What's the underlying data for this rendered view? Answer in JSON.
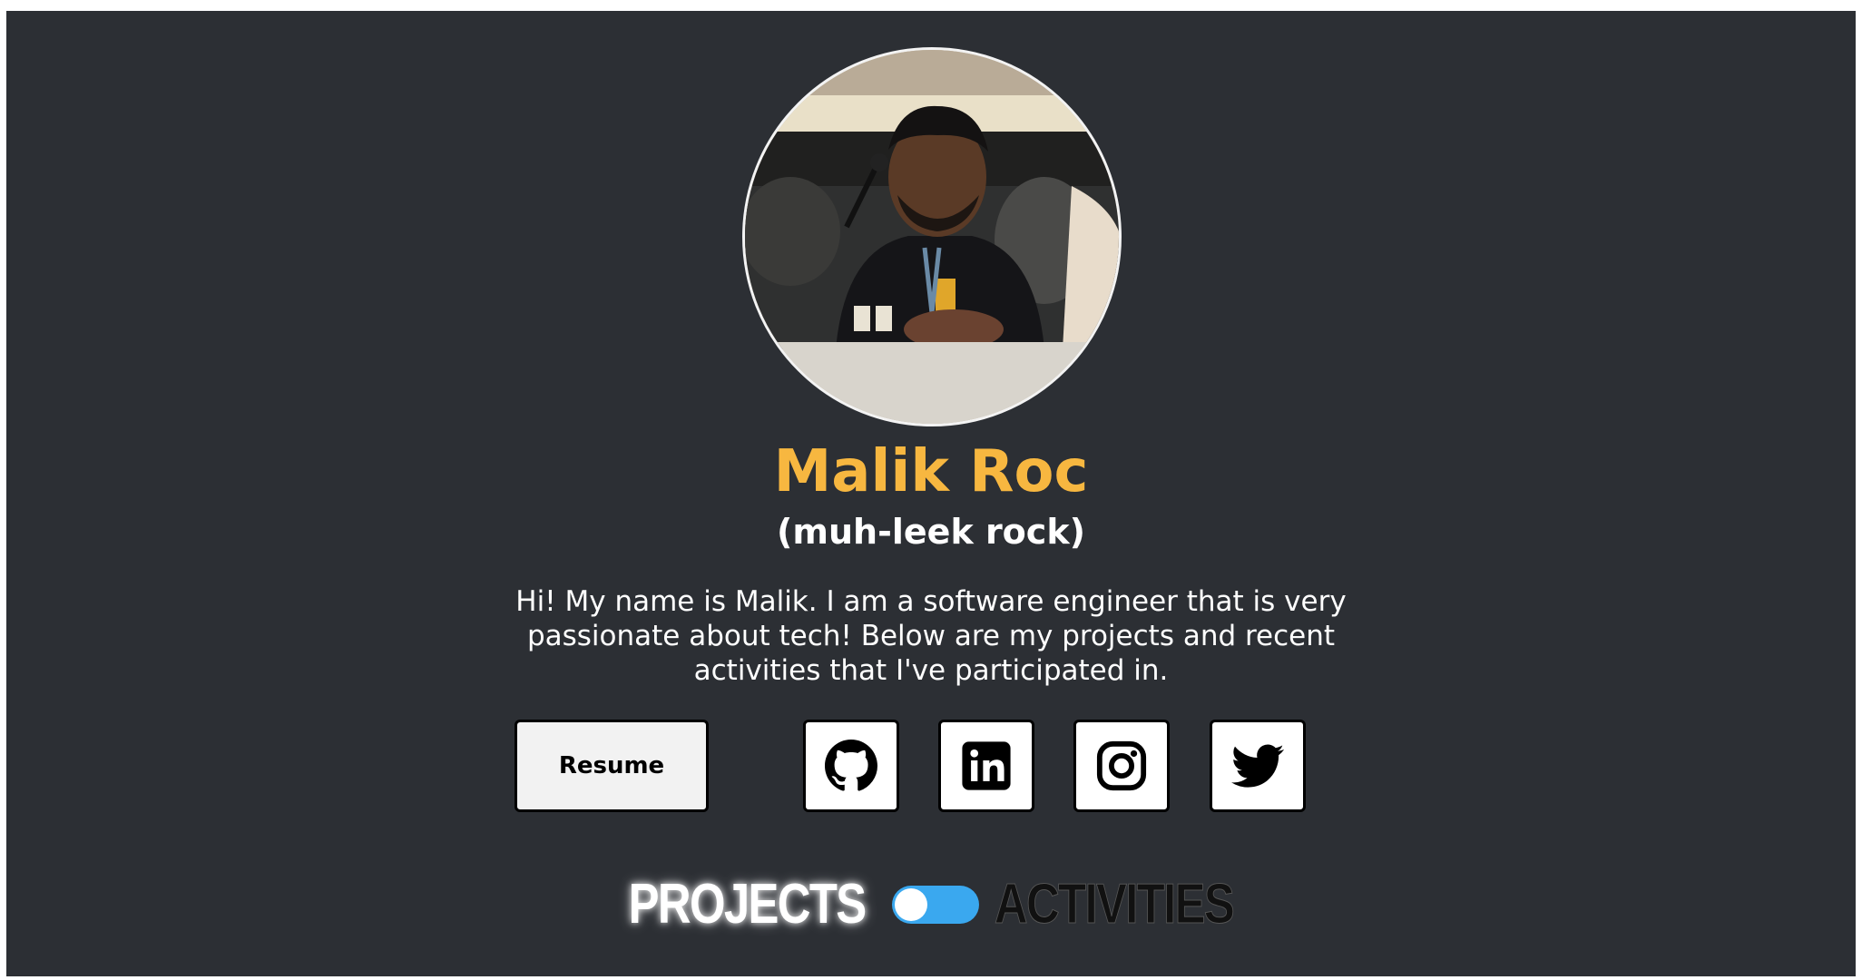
{
  "profile": {
    "name": "Malik Roc",
    "pronunciation": "(muh-leek rock)",
    "bio": "Hi! My name is Malik. I am a software engineer that is very passionate about tech! Below are my projects and recent activities that I've participated in."
  },
  "links": {
    "resume_label": "Resume",
    "social": [
      {
        "icon": "github-icon"
      },
      {
        "icon": "linkedin-icon"
      },
      {
        "icon": "instagram-icon"
      },
      {
        "icon": "twitter-icon"
      }
    ]
  },
  "view_toggle": {
    "left_label": "PROJECTS",
    "right_label": "ACTIVITIES",
    "selected": "PROJECTS"
  },
  "colors": {
    "background": "#2c2f34",
    "name_accent": "#f7b740",
    "toggle_accent": "#3aa8ef"
  }
}
